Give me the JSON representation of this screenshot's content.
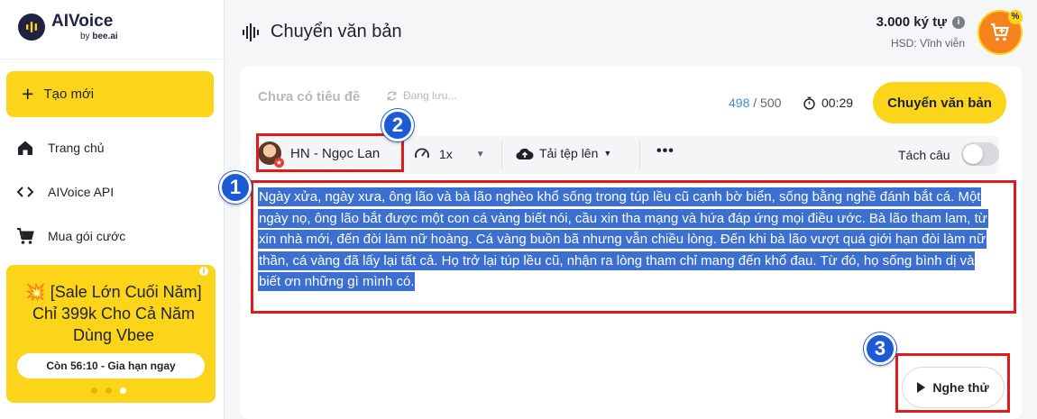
{
  "logo": {
    "title": "AIVoice",
    "sub_by": "by",
    "sub_brand": "bee.ai"
  },
  "sidebar": {
    "new_label": "Tạo mới",
    "items": [
      {
        "label": "Trang chủ",
        "icon": "home-icon"
      },
      {
        "label": "AIVoice API",
        "icon": "code-icon"
      },
      {
        "label": "Mua gói cước",
        "icon": "cart-icon"
      }
    ],
    "promo": {
      "text": "💥 [Sale Lớn Cuối Năm] Chỉ 399k Cho Cả Năm Dùng Vbee",
      "button": "Còn 56:10 - Gia hạn ngay",
      "info": "i"
    }
  },
  "header": {
    "title": "Chuyển văn bản",
    "credits": "3.000 ký tự",
    "credits_info": "i",
    "expiry": "HSD: Vĩnh viễn"
  },
  "editor": {
    "title_placeholder": "Chưa có tiêu đề",
    "saving_status": "Đang lưu...",
    "char_used": "498",
    "char_sep": " / ",
    "char_limit": "500",
    "duration": "00:29",
    "convert_button": "Chuyển văn bản",
    "voice": "HN - Ngọc Lan",
    "speed": "1x",
    "upload": "Tải tệp lên",
    "more": "•••",
    "split_label": "Tách câu",
    "content": "Ngày xửa, ngày xưa, ông lão và bà lão nghèo khổ sống trong túp lều cũ cạnh bờ biển, sống bằng nghề đánh bắt cá. Một ngày nọ, ông lão bắt được một con cá vàng biết nói, cầu xin tha mạng và hứa đáp ứng mọi điều ước. Bà lão tham lam, từ xin nhà mới, đến đòi làm nữ hoàng. Cá vàng buồn bã nhưng vẫn chiều lòng. Đến khi bà lão vượt quá giới hạn đòi làm nữ thần, cá vàng đã lấy lại tất cả. Họ trở lại túp lều cũ, nhận ra lòng tham chỉ mang đến khổ đau. Từ đó, họ sống bình dị và biết ơn những gì mình có.",
    "listen_button": "Nghe thử"
  },
  "annotations": {
    "badge1": "1",
    "badge2": "2",
    "badge3": "3"
  },
  "colors": {
    "accent": "#fcd419",
    "selection": "#3b6fd1",
    "annotation": "#e01b1b",
    "badge": "#1d5bd6"
  }
}
